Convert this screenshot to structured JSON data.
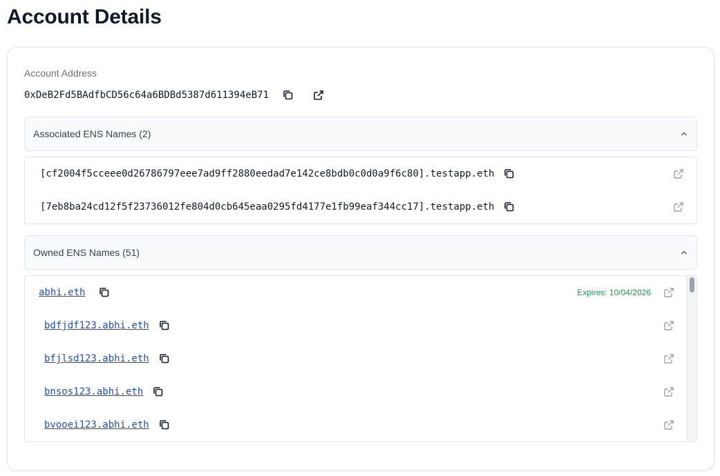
{
  "page": {
    "title": "Account Details"
  },
  "account": {
    "label": "Account Address",
    "address": "0xDeB2Fd5BAdfbCD56c64a6BDBd5387d611394eB71"
  },
  "associated": {
    "title": "Associated ENS Names (2)",
    "names": [
      "[cf2004f5cceee0d26786797eee7ad9ff2880eedad7e142ce8bdb0c0d0a9f6c80].testapp.eth",
      "[7eb8ba24cd12f5f23736012fe804d0cb645eaa0295fd4177e1fb99eaf344cc17].testapp.eth"
    ]
  },
  "owned": {
    "title": "Owned ENS Names (51)",
    "names": [
      {
        "name": "abhi.eth",
        "expires": "Expires: 10/04/2026"
      },
      {
        "name": "bdfjdf123.abhi.eth"
      },
      {
        "name": "bfjlsd123.abhi.eth"
      },
      {
        "name": "bnsos123.abhi.eth"
      },
      {
        "name": "bvooei123.abhi.eth"
      }
    ]
  },
  "colors": {
    "link": "#1d4ed8",
    "expires": "#16a34a",
    "muted": "#6b7280"
  },
  "icons": [
    "copy-icon",
    "external-link-icon",
    "chevron-up-icon"
  ]
}
